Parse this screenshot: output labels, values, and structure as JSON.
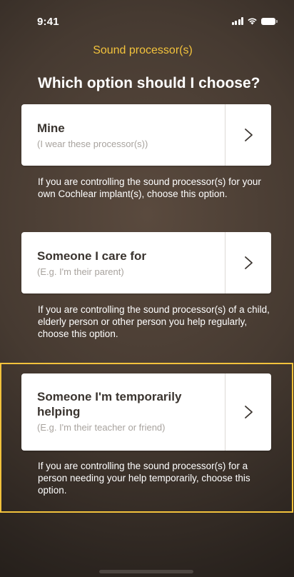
{
  "status_bar": {
    "time": "9:41"
  },
  "header": {
    "title": "Sound processor(s)"
  },
  "page": {
    "heading": "Which option should I choose?"
  },
  "options": [
    {
      "title": "Mine",
      "subtitle": "(I wear these processor(s))",
      "description": "If you are controlling the sound processor(s) for your own Cochlear implant(s), choose this option."
    },
    {
      "title": "Someone I care for",
      "subtitle": "(E.g. I'm their parent)",
      "description": "If you are controlling the sound processor(s) of a child, elderly person or other person you help regularly, choose this option."
    },
    {
      "title": "Someone I'm temporarily helping",
      "subtitle": "(E.g. I'm their teacher or friend)",
      "description": "If you are controlling the sound processor(s) for a person needing your help temporarily, choose this option."
    }
  ],
  "colors": {
    "accent": "#f2c23c",
    "background": "#3f342c",
    "card": "#ffffff",
    "card_title": "#3a342f",
    "card_subtitle": "#a8a39e"
  },
  "icons": {
    "chevron": "chevron-right-icon",
    "signal": "cellular-signal-icon",
    "wifi": "wifi-icon",
    "battery": "battery-icon"
  }
}
